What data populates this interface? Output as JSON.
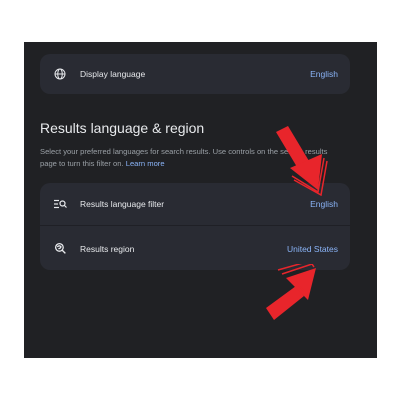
{
  "display_language": {
    "label": "Display language",
    "value": "English",
    "icon": "globe-icon"
  },
  "results_section": {
    "heading": "Results language & region",
    "description": "Select your preferred languages for search results. Use controls on the search results page to turn this filter on.",
    "learn_more": "Learn more"
  },
  "settings": [
    {
      "label": "Results language filter",
      "value": "English",
      "icon": "language-filter-icon"
    },
    {
      "label": "Results region",
      "value": "United States",
      "icon": "region-search-icon"
    }
  ],
  "colors": {
    "background": "#202124",
    "card": "#292b33",
    "text": "#e8eaed",
    "muted": "#9aa0a6",
    "link": "#8ab4f8",
    "annotation_arrow": "#e8252b"
  }
}
